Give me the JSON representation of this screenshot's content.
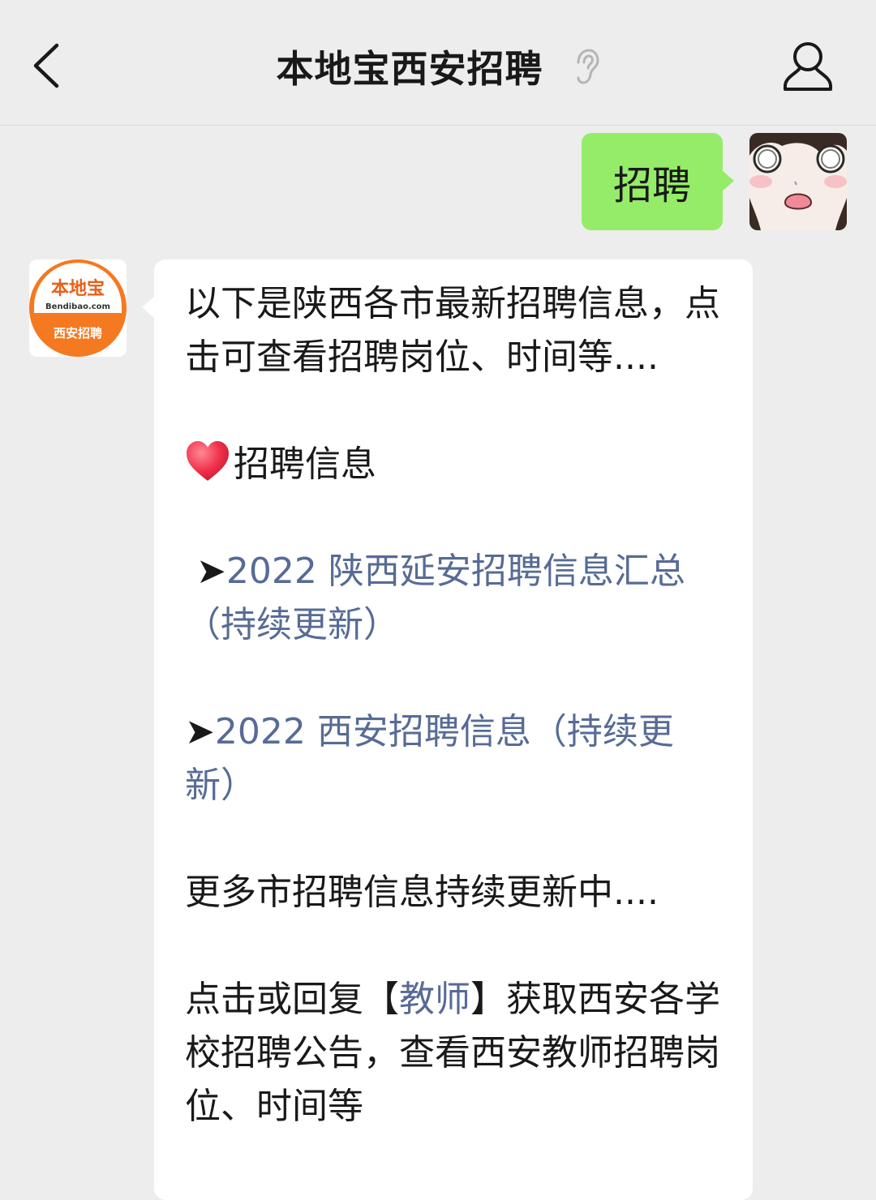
{
  "header": {
    "title": "本地宝西安招聘",
    "back_icon": "chevron-left-icon",
    "voice_icon": "ear-icon",
    "profile_icon": "person-icon"
  },
  "user_message": {
    "text": "招聘",
    "bubble_color": "#95ec69"
  },
  "bot_avatar": {
    "brand": "本地宝",
    "site": "Bendibao.com",
    "subtitle": "西安招聘",
    "color": "#f47920"
  },
  "bot_message": {
    "intro": "以下是陕西各市最新招聘信息，点击可查看招聘岗位、时间等....",
    "section_title": "招聘信息",
    "link1_prefix": "➤",
    "link1": "2022 陕西延安招聘信息汇总（持续更新）",
    "link2_prefix": "➤",
    "link2": "2022 西安招聘信息（持续更新）",
    "more": "更多市招聘信息持续更新中....",
    "teacher_pre": "点击或回复【",
    "teacher_link": "教师",
    "teacher_post": "】获取西安各学校招聘公告，查看西安教师招聘岗位、时间等",
    "link_color": "#576b95"
  }
}
